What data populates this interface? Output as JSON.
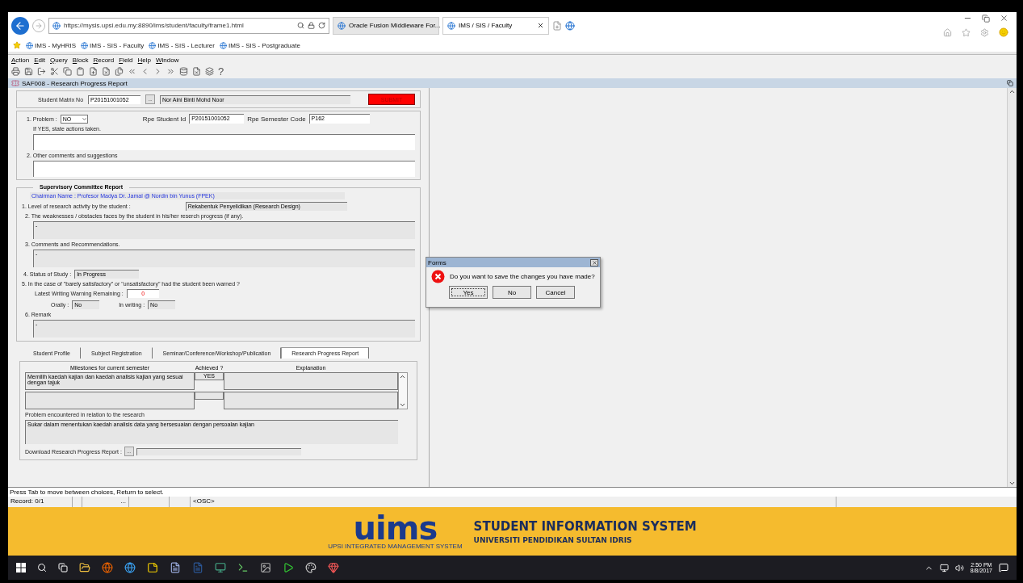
{
  "browser": {
    "url": "https://mysis.upsi.edu.my:8890/ims/student/faculty/frame1.html",
    "tabs": [
      {
        "title": "Oracle Fusion Middleware For...",
        "selected": false
      },
      {
        "title": "IMS / SIS / Faculty",
        "selected": true
      }
    ],
    "favorites": [
      "IMS - MyHRIS",
      "IMS - SIS - Faculty",
      "IMS - SIS - Lecturer",
      "IMS - SIS - Postgraduate"
    ]
  },
  "menu": [
    "Action",
    "Edit",
    "Query",
    "Block",
    "Record",
    "Field",
    "Help",
    "Window"
  ],
  "toolbar": {
    "help_glyph": "?"
  },
  "form_title": "SAF008 -  Research Progress Report",
  "header": {
    "matrix_label": "Student Matrix No",
    "matrix_value": "P20151001052",
    "lookup": "...",
    "name_value": "Nor Aini Binti Mohd Noor",
    "submit": "SUBMIT"
  },
  "student": {
    "problem_label": "1. Problem :",
    "problem_value": "NO",
    "rpe_id_label": "Rpe Student Id",
    "rpe_id_value": "P20151001052",
    "rpe_sem_label": "Rpe Semester Code",
    "rpe_sem_value": "P162",
    "if_yes_label": "If YES, state actions taken.",
    "comments_label": "2. Other comments and suggestions"
  },
  "committee": {
    "title": "Supervisory Committee Report",
    "chairman": "Chairman Name : Profesor Madya Dr. Jamal @ Nordin bin Yunus  (FPEK)",
    "level_label": "1. Level of research activity by the student :",
    "level_value": "Rekabentuk Penyelidikan (Research Design)",
    "weakness_label": "2. The weaknesses / obstacles faces by the student in his/her reserch progress (if any).",
    "weakness_value": "-",
    "recommend_label": "3. Comments and Recommendations.",
    "recommend_value": "-",
    "status_label": "4. Status of Study :",
    "status_value": "In Progress",
    "warned_label": "5. In the case of \"barely satisfactory\" or \"unsatisfactory\" had the student been warned ?",
    "warning_label": "Latest Writing Warning Remaining :",
    "warning_value": "0",
    "orally_label": "Orally :",
    "orally_value": "No",
    "writing_label": "In writing :",
    "writing_value": "No",
    "remark_label": "6. Remark",
    "remark_value": "-"
  },
  "tabs": [
    {
      "label": "Student Profile",
      "selected": false
    },
    {
      "label": "Subject Registration",
      "selected": false
    },
    {
      "label": "Seminar/Conference/Workshop/Publication",
      "selected": false
    },
    {
      "label": "Research Progress Report",
      "selected": true
    }
  ],
  "milestones": {
    "columns": [
      "Milestones for current semester",
      "Achieved ?",
      "Explanation"
    ],
    "rows": [
      {
        "milestone": "Memilih kaedah kajian dan kaedah analisis kajian yang sesuai dengan tajuk",
        "achieved": "YES"
      }
    ],
    "problem_label": "Problem encountered in relation to the research",
    "problem_value": "Sukar dalam menentukan kaedah analisis data yang bersesuaian dengan persoalan kajian",
    "download_label": "Download Research Progress Report :",
    "download_button": "..."
  },
  "hint": "Press Tab to move between choices, Return to select.",
  "status_bar": {
    "record": "Record: 0/1",
    "ellipsis": "...",
    "mode": "<OSC>"
  },
  "dialog": {
    "title": "Forms",
    "message": "Do you want to save the changes you have made?",
    "buttons": [
      {
        "label": "Yes",
        "selected": true
      },
      {
        "label": "No",
        "selected": false
      },
      {
        "label": "Cancel",
        "selected": false
      }
    ]
  },
  "banner": {
    "logo": "uims",
    "logo_caption": "UPSI INTEGRATED MANAGEMENT SYSTEM",
    "title": "STUDENT INFORMATION SYSTEM",
    "subtitle": "UNIVERSITI PENDIDIKAN SULTAN IDRIS"
  },
  "taskbar": {
    "time": "2:50 PM",
    "date": "8/8/2017"
  }
}
